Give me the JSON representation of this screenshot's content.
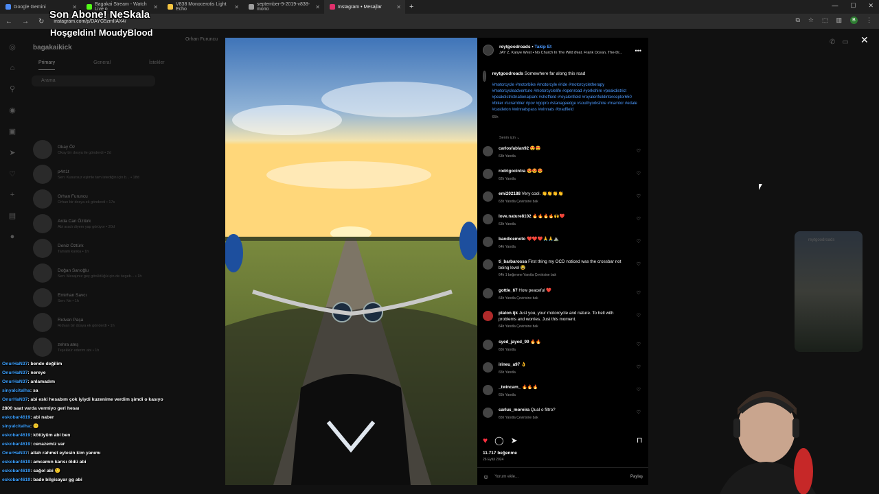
{
  "browser": {
    "tabs": [
      {
        "label": "Google Gemini",
        "color": "#4c8bf5"
      },
      {
        "label": "Bagakai Stream - Watch Live o",
        "color": "#53fc18"
      },
      {
        "label": "V838 Monocerotis Light Echo",
        "color": "#f5c542"
      },
      {
        "label": "september-9-2019-v838-mono",
        "color": "#9e9e9e"
      },
      {
        "label": "Instagram • Mesajlar",
        "color": "#e1306c"
      }
    ],
    "url": "instagram.com/p/DAYG5zmIIAX4/",
    "profile_initial": "B"
  },
  "stream_overlay": {
    "title": "Son Abone! NeSkala",
    "subtitle": "Hoşgeldin! MoudyBlood"
  },
  "stream_chat": [
    {
      "user": "OnurHaN37",
      "msg": ": bende değilim"
    },
    {
      "user": "OnurHaN37",
      "msg": ": nereye"
    },
    {
      "user": "OnurHaN37",
      "msg": ": anlamadım"
    },
    {
      "user": "sinyalcitalha",
      "msg": ": sa"
    },
    {
      "user": "OnurHaN37",
      "msg": ": abi eski hesabım çok iyiydi kuzenime verdim şimdi o kasıyo"
    },
    {
      "user": "",
      "msg": "2800 saat varda vermiyo geri hesaı"
    },
    {
      "user": "eskobar4619",
      "msg": ": abi naber"
    },
    {
      "user": "sinyalcitalha",
      "msg": ": 🙂"
    },
    {
      "user": "eskobar4619",
      "msg": ": kötüyüm abi ben"
    },
    {
      "user": "eskobar4619",
      "msg": ": cenazemiz var"
    },
    {
      "user": "OnurHaN37",
      "msg": ": allah rahmet eylesin kim yanımı"
    },
    {
      "user": "eskobar4619",
      "msg": ": amcamın karısı öldü abi"
    },
    {
      "user": "eskobar4619",
      "msg": ": sağol abi 🙂"
    },
    {
      "user": "eskobar4619",
      "msg": ": bade bilgisayar gg abi"
    }
  ],
  "dm": {
    "username": "bagakaikick",
    "tabs": [
      "Primary",
      "General",
      "İstekler"
    ],
    "search_placeholder": "Arama",
    "conversations": [
      {
        "name": "Okay Öz",
        "sub": "Okay bir dosya ile gönderdi • 2d"
      },
      {
        "name": "p4rt1t",
        "sub": "Sen: Kusursuz eşimle tam istediğin için b... • 18d"
      },
      {
        "name": "Orhan Furuncu",
        "sub": "Orhan bir dosya ek gönderdi • 17s"
      },
      {
        "name": "Arda Can Öztürk",
        "sub": "Abi aradı diyem yap görüyor • 20d"
      },
      {
        "name": "Deniz Öztürk",
        "sub": "Tamam kanka • 1h"
      },
      {
        "name": "Doğan Sarıoğlu",
        "sub": "Sen: Mesajınız geç görüldüğü için de özgeb... • 1h"
      },
      {
        "name": "Emirhan Savcı",
        "sub": "Sen: Ne • 1h"
      },
      {
        "name": "Rıdvan Paşa",
        "sub": "Rıdvan bir dosya ek gönderdi • 1h"
      },
      {
        "name": "zehra ateş",
        "sub": "Teşekkür ederim abi • 1h"
      }
    ],
    "chat_header": "Orhan Furuncu"
  },
  "post": {
    "handle": "reytgoodroads",
    "follow_label": "Takip Et",
    "music": "JAY Z, Kanye West • No Church In The Wild (feat. Frank Ocean, The-Dr...",
    "caption": "Somewhere far along this road",
    "hashtags": "#motorcycle #motorbike #motorcyle #ride #motorcycletherapy #motorcycleadventure #motorcyclelife #openroad #yorkshire #peakdistrict #peakdistrictnationalpark #sheffield #royalenfield #royalenfieldinterceptor650 #biker #scrambler #pov #gopro #stanageedge #southyorkshire #mamtor #edale #castleton #winnatspass #winnats #bradfield",
    "caption_age": "65h",
    "sort_label": "Senin için",
    "comments": [
      {
        "user": "carlosfablan92",
        "text": "😍😍",
        "meta": "63h   Yanıtla"
      },
      {
        "user": "rodrigocintra",
        "text": "😍😍😍",
        "meta": "62h   Yanıtla"
      },
      {
        "user": "emi202188",
        "text": "Very cool. 👏👏👏👏",
        "meta": "63h   Yanıtla   Çevirisine bak"
      },
      {
        "user": "love.nature8102",
        "text": "🔥🔥🔥🔥🙌❤️",
        "meta": "63h   Yanıtla"
      },
      {
        "user": "bandicemoto",
        "text": "❤️❤️❤️🙏🙏⛰️",
        "meta": "64h   Yanıtla"
      },
      {
        "user": "ti_barbarossa",
        "text": "First thing my OCD noticed was the crossbar not being level 😂",
        "meta": "64h   1 beğenme   Yanıtla   Çevirisine bak"
      },
      {
        "user": "gottle_67",
        "text": "How peaceful ❤️",
        "meta": "64h   Yanıtla   Çevirisine bak"
      },
      {
        "user": "platon.tjk",
        "text": "Just you, your motorcycle and nature. To hell with problems and worries. Just this moment.",
        "meta": "64h   Yanıtla   Çevirisine bak"
      },
      {
        "user": "syed_jayed_99",
        "text": "🔥🔥",
        "meta": "65h   Yanıtla"
      },
      {
        "user": "irineu_a97",
        "text": "👌",
        "meta": "65h   Yanıtla"
      },
      {
        "user": "_twincam_",
        "text": "🔥🔥🔥",
        "meta": "65h   Yanıtla"
      },
      {
        "user": "carlus_moreira",
        "text": "Qual o filtro?",
        "meta": "65h   Yanıtla   Çevirisine bak"
      }
    ],
    "likes": "11.717 beğenme",
    "date": "26 Eylül 2024",
    "comment_placeholder": "Yorum ekle...",
    "post_button": "Paylaş"
  },
  "reel_thumb_user": "reytgoodroads",
  "colors": {
    "accent_link": "#4c9aff",
    "like": "#ff3040",
    "chat_user": "#3aa0ff"
  }
}
